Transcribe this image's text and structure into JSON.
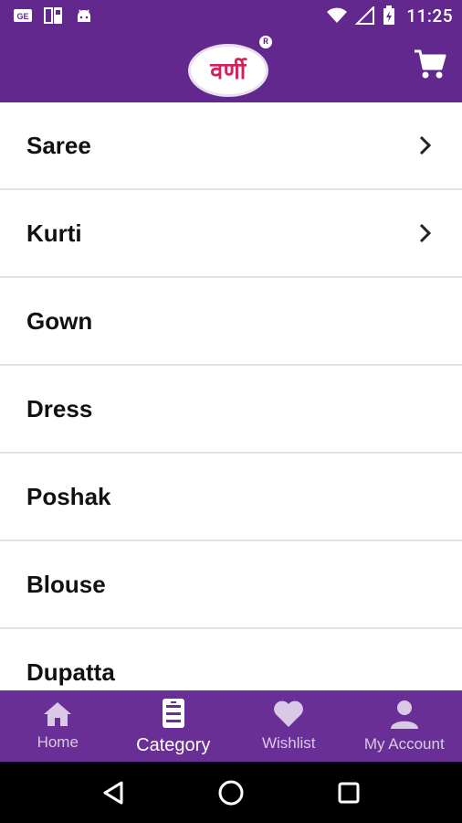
{
  "status_bar": {
    "time": "11:25",
    "left_icons": [
      "gmail-icon",
      "sim-toolkit-icon",
      "android-icon"
    ],
    "right_icons": [
      "wifi-icon",
      "signal-icon",
      "battery-charging-icon"
    ]
  },
  "header": {
    "logo_text": "वर्णी",
    "registered_mark": "R",
    "cart_icon": "cart-icon",
    "background_color": "#62288e"
  },
  "categories": [
    {
      "label": "Saree",
      "has_children": true
    },
    {
      "label": "Kurti",
      "has_children": true
    },
    {
      "label": "Gown",
      "has_children": false
    },
    {
      "label": "Dress",
      "has_children": false
    },
    {
      "label": "Poshak",
      "has_children": false
    },
    {
      "label": "Blouse",
      "has_children": false
    },
    {
      "label": "Dupatta",
      "has_children": false
    }
  ],
  "bottom_nav": {
    "items": [
      {
        "label": "Home",
        "icon": "home-icon",
        "active": false
      },
      {
        "label": "Category",
        "icon": "category-icon",
        "active": true
      },
      {
        "label": "Wishlist",
        "icon": "heart-icon",
        "active": false
      },
      {
        "label": "My Account",
        "icon": "user-icon",
        "active": false
      }
    ]
  },
  "system_nav": [
    "back-icon",
    "home-circle-icon",
    "recents-icon"
  ]
}
